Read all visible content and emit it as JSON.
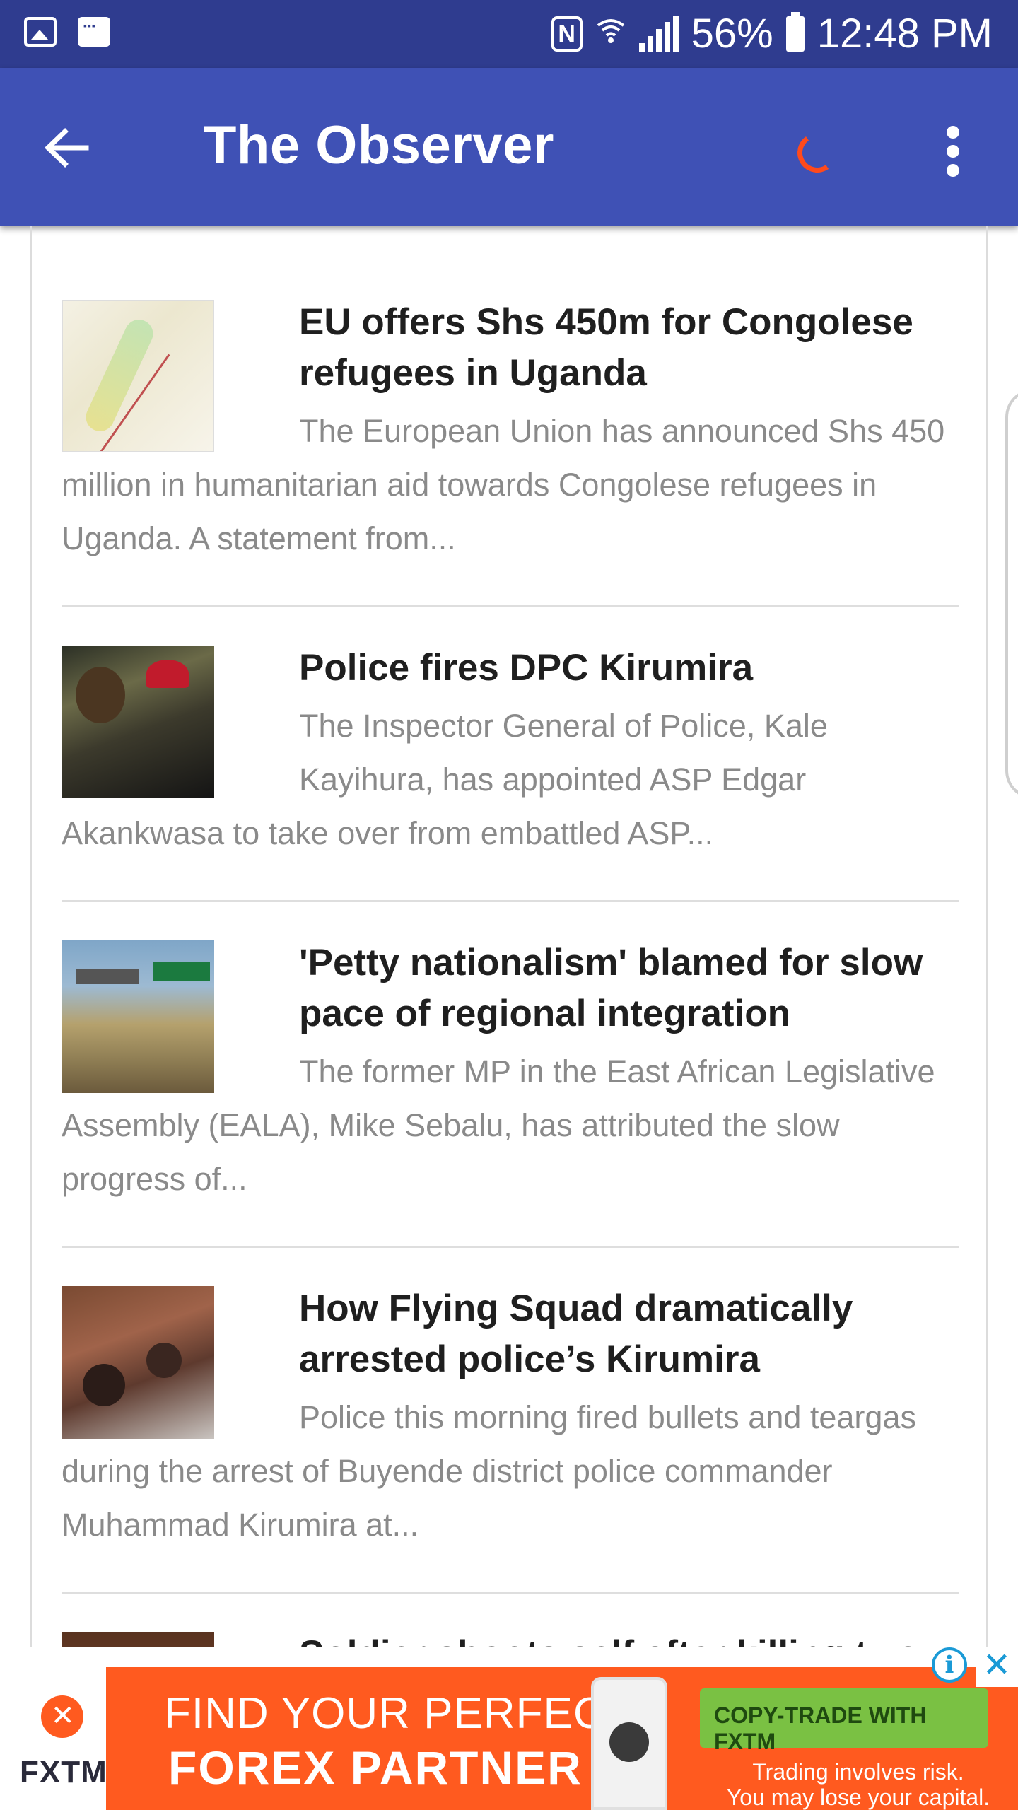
{
  "status_bar": {
    "battery": "56%",
    "time": "12:48 PM",
    "icons": [
      "gallery-icon",
      "message-icon",
      "nfc-icon",
      "wifi-icon",
      "signal-icon",
      "battery-icon"
    ]
  },
  "app_bar": {
    "title": "The Observer",
    "colors": {
      "bar": "#3f51b5",
      "status": "#2f3c8f",
      "spinner": "#ff4a1c"
    }
  },
  "articles": [
    {
      "title": "EU offers Shs 450m for Congolese refugees in Uganda",
      "summary": "The European Union has announced Shs 450 million in humanitarian aid towards Congolese refugees in Uganda. A statement from..."
    },
    {
      "title": "Police fires DPC Kirumira",
      "summary": "The Inspector General of Police, Kale Kayihura, has appointed ASP Edgar Akankwasa to take over from embattled ASP..."
    },
    {
      "title": "'Petty nationalism' blamed for slow pace of regional integration",
      "summary": "The former MP in the East African Legislative Assembly (EALA), Mike Sebalu, has attributed the slow progress of..."
    },
    {
      "title": "How Flying Squad dramatically arrested police’s Kirumira",
      "summary": "Police this morning fired bullets and teargas during the arrest of Buyende district police commander Muhammad Kirumira at..."
    },
    {
      "title": "Soldier shoots self after killing two",
      "summary": ""
    }
  ],
  "ad": {
    "brand": "FXTM",
    "headline_1": "FIND YOUR PERFECT",
    "headline_2": "FOREX PARTNER",
    "cta": "COPY-TRADE WITH FXTM",
    "risk_1": "Trading involves risk.",
    "risk_2": "You may lose your capital.",
    "info_glyph": "i",
    "close_glyph": "✕",
    "colors": {
      "background": "#ff5a1f",
      "cta": "#7ac143"
    }
  }
}
